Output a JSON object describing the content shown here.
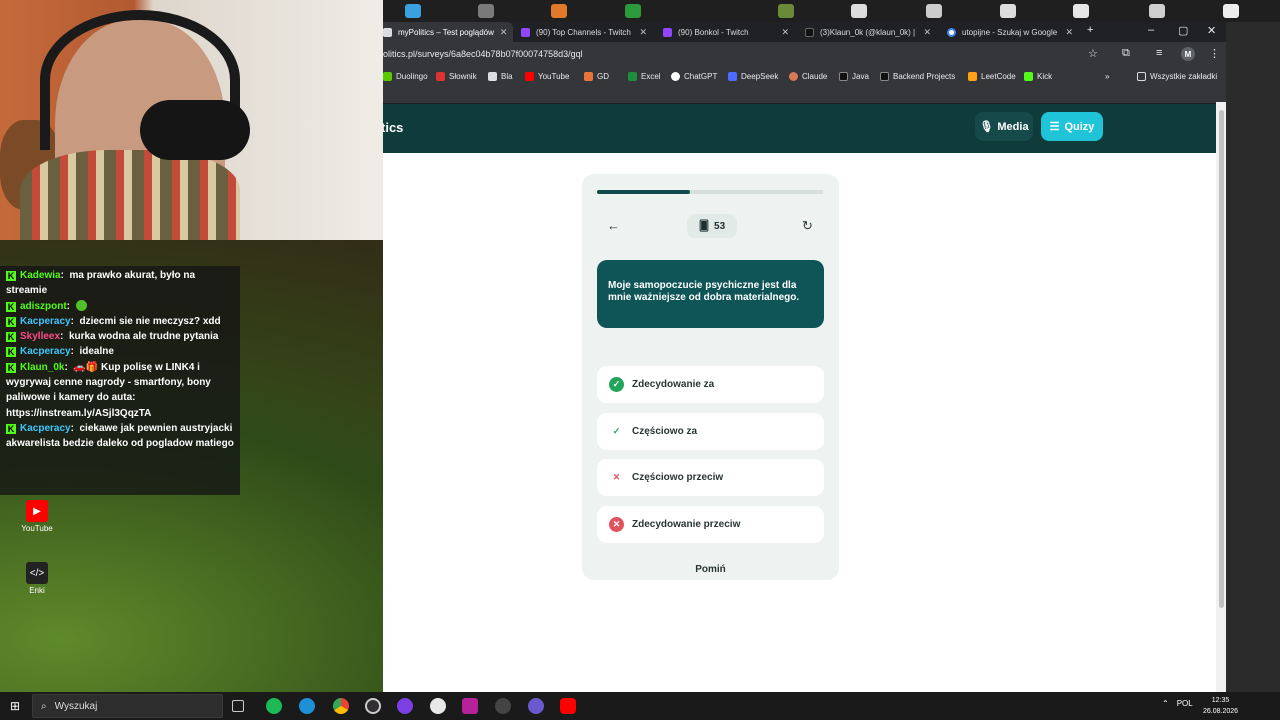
{
  "browser": {
    "tabs": [
      {
        "label": "myPolitics – Test poglądów",
        "color": "#dadce0"
      },
      {
        "label": "(90) Top Channels - Twitch",
        "color": "#9146ff"
      },
      {
        "label": "(90) Bonkol - Twitch",
        "color": "#9146ff"
      },
      {
        "label": "(3)Klaun_0k (@klaun_0k) |",
        "color": "#111111"
      },
      {
        "label": "utopijne - Szukaj w Google",
        "color": "#4285f4"
      }
    ],
    "url": "olitics.pl/surveys/6a8ec04b78b07f00074758d3/gql",
    "profile_initial": "M",
    "bookmarks": [
      "Duolingo",
      "Słownik",
      "Bla",
      "YouTube",
      "GD",
      "Excel",
      "ChatGPT",
      "DeepSeek",
      "Claude",
      "Java",
      "Backend Projects",
      "LeetCode",
      "Kick"
    ],
    "all_bookmarks": "Wszystkie zakładki"
  },
  "site": {
    "brand_fragment": "tics",
    "media_label": "Media",
    "quiz_label": "Quizy",
    "accent": "#20c4d8",
    "header_color": "#0f3b3b"
  },
  "survey": {
    "progress": 0.41,
    "counter": "53",
    "question": "Moje samopoczucie psychiczne jest dla mnie ważniejsze od dobra materialnego.",
    "options": [
      {
        "label": "Zdecydowanie za",
        "icon": "check-circle-icon"
      },
      {
        "label": "Częściowo za",
        "icon": "check-icon"
      },
      {
        "label": "Częściowo przeciw",
        "icon": "x-icon"
      },
      {
        "label": "Zdecydowanie przeciw",
        "icon": "x-circle-icon"
      }
    ],
    "skip_label": "Pomiń"
  },
  "chat": {
    "messages": [
      {
        "user": "Kadewia",
        "text": "ma prawko akurat, było na streamie",
        "user_color": "#53fc18"
      },
      {
        "user": "adiszpont",
        "text": "",
        "user_color": "#53fc18"
      },
      {
        "user": "Kacperacy",
        "text": "dziecmi sie nie meczysz? xdd",
        "user_color": "#3ec7ff"
      },
      {
        "user": "Skylleex",
        "text": "kurka wodna ale trudne pytania",
        "user_color": "#ff4b8b"
      },
      {
        "user": "Kacperacy",
        "text": "idealne",
        "user_color": "#3ec7ff"
      },
      {
        "user": "Klaun_0k",
        "text": "Kup polisę w LINK4 i wygrywaj cenne nagrody - smartfony, bony paliwowe i kamery do auta: https://instream.ly/ASjl3QqzTA",
        "user_color": "#53fc18"
      },
      {
        "user": "Kacperacy",
        "text": "ciekawe jak pewnien austryjacki akwarelista bedzie daleko od pogladow matiego",
        "user_color": "#3ec7ff"
      }
    ]
  },
  "desktop": {
    "icons": [
      {
        "label": "YouTube",
        "icon": "youtube-icon"
      },
      {
        "label": "Enki",
        "icon": "code-icon"
      }
    ]
  },
  "taskbar": {
    "search_placeholder": "Wyszukaj",
    "language": "POL",
    "time": "12:35",
    "date": "26.08.2026"
  }
}
